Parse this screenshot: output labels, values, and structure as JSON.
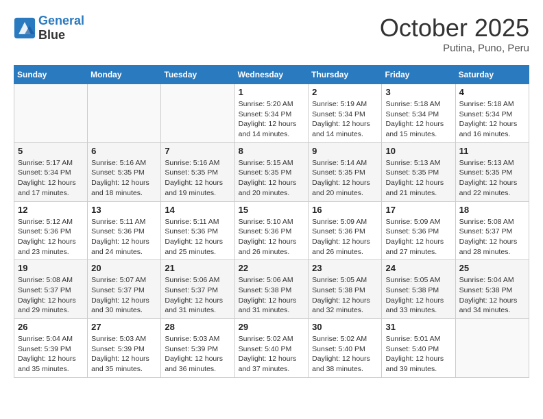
{
  "header": {
    "logo_line1": "General",
    "logo_line2": "Blue",
    "month": "October 2025",
    "location": "Putina, Puno, Peru"
  },
  "weekdays": [
    "Sunday",
    "Monday",
    "Tuesday",
    "Wednesday",
    "Thursday",
    "Friday",
    "Saturday"
  ],
  "weeks": [
    [
      {
        "day": "",
        "info": ""
      },
      {
        "day": "",
        "info": ""
      },
      {
        "day": "",
        "info": ""
      },
      {
        "day": "1",
        "info": "Sunrise: 5:20 AM\nSunset: 5:34 PM\nDaylight: 12 hours\nand 14 minutes."
      },
      {
        "day": "2",
        "info": "Sunrise: 5:19 AM\nSunset: 5:34 PM\nDaylight: 12 hours\nand 14 minutes."
      },
      {
        "day": "3",
        "info": "Sunrise: 5:18 AM\nSunset: 5:34 PM\nDaylight: 12 hours\nand 15 minutes."
      },
      {
        "day": "4",
        "info": "Sunrise: 5:18 AM\nSunset: 5:34 PM\nDaylight: 12 hours\nand 16 minutes."
      }
    ],
    [
      {
        "day": "5",
        "info": "Sunrise: 5:17 AM\nSunset: 5:34 PM\nDaylight: 12 hours\nand 17 minutes."
      },
      {
        "day": "6",
        "info": "Sunrise: 5:16 AM\nSunset: 5:35 PM\nDaylight: 12 hours\nand 18 minutes."
      },
      {
        "day": "7",
        "info": "Sunrise: 5:16 AM\nSunset: 5:35 PM\nDaylight: 12 hours\nand 19 minutes."
      },
      {
        "day": "8",
        "info": "Sunrise: 5:15 AM\nSunset: 5:35 PM\nDaylight: 12 hours\nand 20 minutes."
      },
      {
        "day": "9",
        "info": "Sunrise: 5:14 AM\nSunset: 5:35 PM\nDaylight: 12 hours\nand 20 minutes."
      },
      {
        "day": "10",
        "info": "Sunrise: 5:13 AM\nSunset: 5:35 PM\nDaylight: 12 hours\nand 21 minutes."
      },
      {
        "day": "11",
        "info": "Sunrise: 5:13 AM\nSunset: 5:35 PM\nDaylight: 12 hours\nand 22 minutes."
      }
    ],
    [
      {
        "day": "12",
        "info": "Sunrise: 5:12 AM\nSunset: 5:36 PM\nDaylight: 12 hours\nand 23 minutes."
      },
      {
        "day": "13",
        "info": "Sunrise: 5:11 AM\nSunset: 5:36 PM\nDaylight: 12 hours\nand 24 minutes."
      },
      {
        "day": "14",
        "info": "Sunrise: 5:11 AM\nSunset: 5:36 PM\nDaylight: 12 hours\nand 25 minutes."
      },
      {
        "day": "15",
        "info": "Sunrise: 5:10 AM\nSunset: 5:36 PM\nDaylight: 12 hours\nand 26 minutes."
      },
      {
        "day": "16",
        "info": "Sunrise: 5:09 AM\nSunset: 5:36 PM\nDaylight: 12 hours\nand 26 minutes."
      },
      {
        "day": "17",
        "info": "Sunrise: 5:09 AM\nSunset: 5:36 PM\nDaylight: 12 hours\nand 27 minutes."
      },
      {
        "day": "18",
        "info": "Sunrise: 5:08 AM\nSunset: 5:37 PM\nDaylight: 12 hours\nand 28 minutes."
      }
    ],
    [
      {
        "day": "19",
        "info": "Sunrise: 5:08 AM\nSunset: 5:37 PM\nDaylight: 12 hours\nand 29 minutes."
      },
      {
        "day": "20",
        "info": "Sunrise: 5:07 AM\nSunset: 5:37 PM\nDaylight: 12 hours\nand 30 minutes."
      },
      {
        "day": "21",
        "info": "Sunrise: 5:06 AM\nSunset: 5:37 PM\nDaylight: 12 hours\nand 31 minutes."
      },
      {
        "day": "22",
        "info": "Sunrise: 5:06 AM\nSunset: 5:38 PM\nDaylight: 12 hours\nand 31 minutes."
      },
      {
        "day": "23",
        "info": "Sunrise: 5:05 AM\nSunset: 5:38 PM\nDaylight: 12 hours\nand 32 minutes."
      },
      {
        "day": "24",
        "info": "Sunrise: 5:05 AM\nSunset: 5:38 PM\nDaylight: 12 hours\nand 33 minutes."
      },
      {
        "day": "25",
        "info": "Sunrise: 5:04 AM\nSunset: 5:38 PM\nDaylight: 12 hours\nand 34 minutes."
      }
    ],
    [
      {
        "day": "26",
        "info": "Sunrise: 5:04 AM\nSunset: 5:39 PM\nDaylight: 12 hours\nand 35 minutes."
      },
      {
        "day": "27",
        "info": "Sunrise: 5:03 AM\nSunset: 5:39 PM\nDaylight: 12 hours\nand 35 minutes."
      },
      {
        "day": "28",
        "info": "Sunrise: 5:03 AM\nSunset: 5:39 PM\nDaylight: 12 hours\nand 36 minutes."
      },
      {
        "day": "29",
        "info": "Sunrise: 5:02 AM\nSunset: 5:40 PM\nDaylight: 12 hours\nand 37 minutes."
      },
      {
        "day": "30",
        "info": "Sunrise: 5:02 AM\nSunset: 5:40 PM\nDaylight: 12 hours\nand 38 minutes."
      },
      {
        "day": "31",
        "info": "Sunrise: 5:01 AM\nSunset: 5:40 PM\nDaylight: 12 hours\nand 39 minutes."
      },
      {
        "day": "",
        "info": ""
      }
    ]
  ]
}
